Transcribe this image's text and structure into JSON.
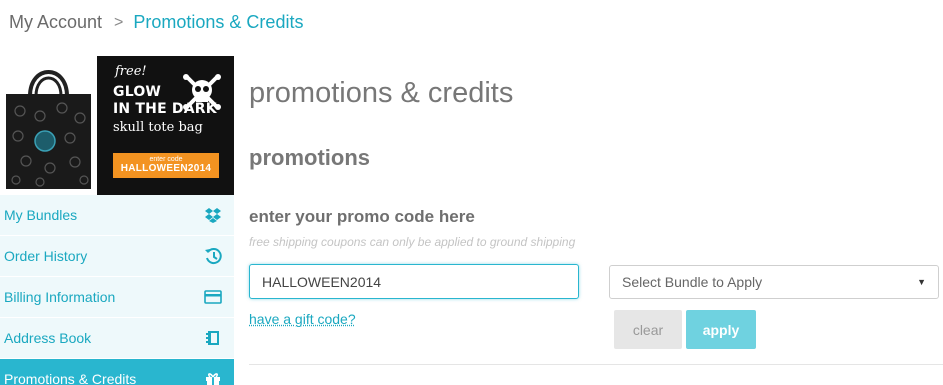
{
  "breadcrumb": {
    "root": "My Account",
    "separator": ">",
    "current": "Promotions & Credits"
  },
  "banner": {
    "free": "free!",
    "headline_line1": "GLOW",
    "headline_line2": "IN THE DARK",
    "subtitle": "skull tote bag",
    "code_label": "enter code",
    "code": "HALLOWEEN2014",
    "accent_color": "#f39321"
  },
  "sidebar": {
    "items": [
      {
        "label": "My Bundles",
        "icon": "dropbox-icon"
      },
      {
        "label": "Order History",
        "icon": "history-icon"
      },
      {
        "label": "Billing Information",
        "icon": "credit-card-icon"
      },
      {
        "label": "Address Book",
        "icon": "address-book-icon"
      },
      {
        "label": "Promotions & Credits",
        "icon": "gift-icon",
        "active": true
      }
    ]
  },
  "main": {
    "title": "promotions & credits",
    "section_title": "promotions",
    "promo_heading": "enter your promo code here",
    "promo_note": "free shipping coupons can only be applied to ground shipping",
    "promo_input_value": "HALLOWEEN2014",
    "bundle_select_value": "Select Bundle to Apply",
    "gift_link": "have a gift code?",
    "clear_label": "clear",
    "apply_label": "apply"
  },
  "colors": {
    "accent": "#1aa8c0",
    "sidebar_bg": "#eef9fb",
    "sidebar_active": "#29b6cf",
    "apply_button": "#6fd2e0"
  }
}
